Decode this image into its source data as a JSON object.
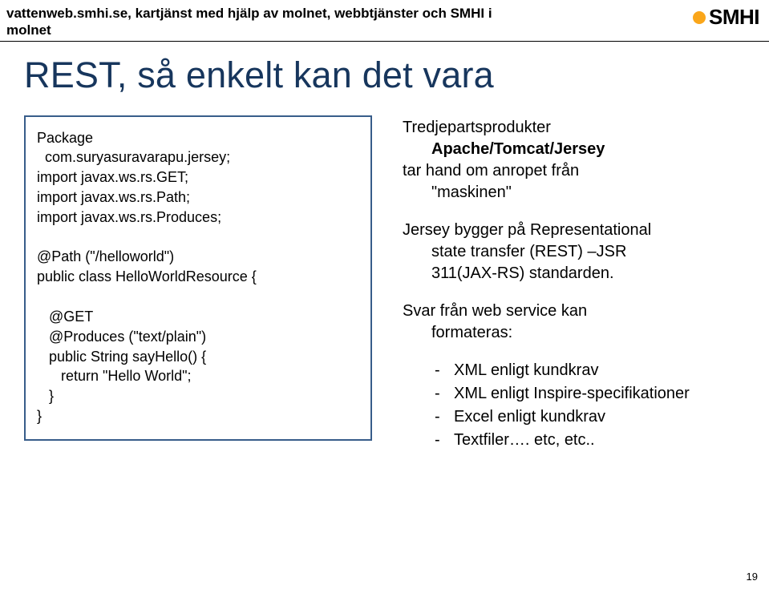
{
  "header": {
    "line1": "vattenweb.smhi.se, kartjänst med hjälp av molnet, webbtjänster och SMHI i",
    "line2": "molnet",
    "logo_text": "SMHI"
  },
  "slide_title": "REST, så enkelt kan det vara",
  "code": {
    "l1": "Package",
    "l2": "  com.suryasuravarapu.jersey;",
    "l3": "import javax.ws.rs.GET;",
    "l4": "import javax.ws.rs.Path;",
    "l5": "import javax.ws.rs.Produces;",
    "l6": "",
    "l7": "@Path (\"/helloworld\")",
    "l8": "public class HelloWorldResource {",
    "l9": "",
    "l10": "   @GET",
    "l11": "   @Produces (\"text/plain\")",
    "l12": "   public String sayHello() {",
    "l13": "      return \"Hello World\";",
    "l14": "   }",
    "l15": "}"
  },
  "right": {
    "p1_a": "Tredjepartsprodukter",
    "p1_b": "Apache/Tomcat/Jersey",
    "p1_c": "tar hand om anropet från",
    "p1_d": "\"maskinen\"",
    "p2_a": "Jersey bygger på Representational",
    "p2_b": "state transfer (REST) –JSR",
    "p2_c": "311(JAX-RS) standarden.",
    "p3_a": "Svar från web service kan",
    "p3_b": "formateras:",
    "bullets": {
      "b1": "XML enligt kundkrav",
      "b2": "XML enligt Inspire-specifikationer",
      "b3": "Excel enligt kundkrav",
      "b4": "Textfiler…. etc, etc.."
    }
  },
  "page_number": "19"
}
